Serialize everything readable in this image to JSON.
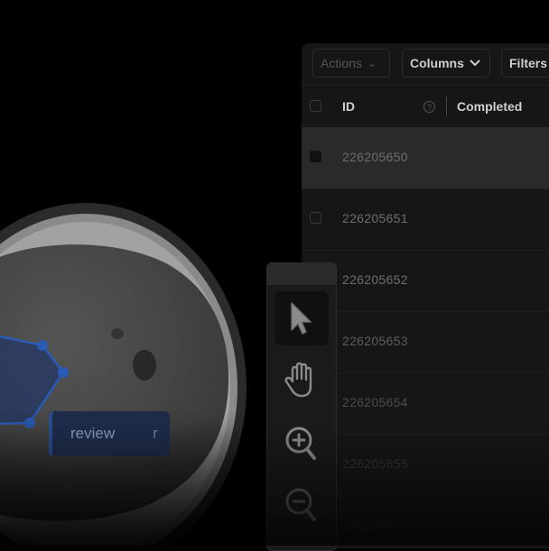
{
  "annotation": {
    "label": "review",
    "extra": "r"
  },
  "toolbar": {
    "actions_label": "Actions",
    "columns_label": "Columns",
    "filters_label": "Filters"
  },
  "table": {
    "headers": {
      "id": "ID",
      "help": "?",
      "completed": "Completed"
    },
    "rows": [
      {
        "id": "226205650",
        "selected": true
      },
      {
        "id": "226205651",
        "selected": false
      },
      {
        "id": "226205652",
        "selected": false
      },
      {
        "id": "226205653",
        "selected": false
      },
      {
        "id": "226205654",
        "selected": false
      },
      {
        "id": "226205655",
        "selected": false
      },
      {
        "id": "226205656",
        "selected": false
      }
    ]
  },
  "tools": [
    {
      "name": "pointer",
      "icon": "cursor-arrow-icon",
      "active": true
    },
    {
      "name": "pan",
      "icon": "hand-icon",
      "active": false
    },
    {
      "name": "zoom-in",
      "icon": "zoom-in-icon",
      "active": false
    },
    {
      "name": "zoom-out",
      "icon": "zoom-out-icon",
      "active": false
    }
  ],
  "colors": {
    "background": "#000000",
    "panel": "#161616",
    "annotation_fill": "#1d2b48",
    "annotation_stroke": "#2b5bb5"
  }
}
